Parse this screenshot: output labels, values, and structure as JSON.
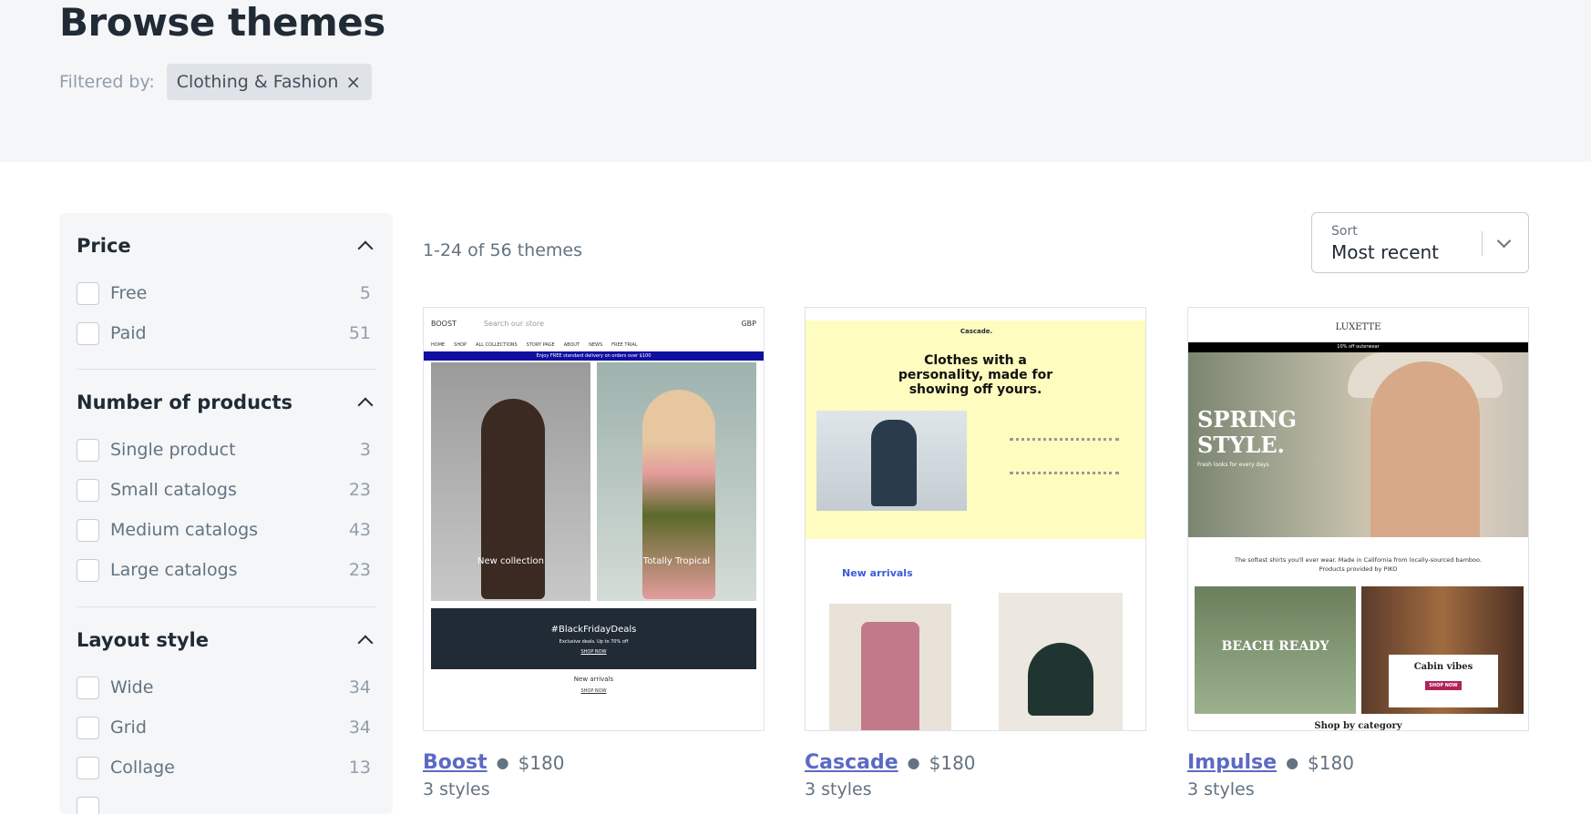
{
  "page": {
    "title": "Browse themes",
    "filter_label": "Filtered by:",
    "active_filter": "Clothing & Fashion",
    "remove_filter_glyph": "×"
  },
  "sidebar": {
    "sections": [
      {
        "title": "Price",
        "options": [
          {
            "label": "Free",
            "count": "5"
          },
          {
            "label": "Paid",
            "count": "51"
          }
        ]
      },
      {
        "title": "Number of products",
        "options": [
          {
            "label": "Single product",
            "count": "3"
          },
          {
            "label": "Small catalogs",
            "count": "23"
          },
          {
            "label": "Medium catalogs",
            "count": "43"
          },
          {
            "label": "Large catalogs",
            "count": "23"
          }
        ]
      },
      {
        "title": "Layout style",
        "options": [
          {
            "label": "Wide",
            "count": "34"
          },
          {
            "label": "Grid",
            "count": "34"
          },
          {
            "label": "Collage",
            "count": "13"
          }
        ]
      }
    ]
  },
  "results": {
    "summary": "1-24 of 56 themes"
  },
  "sort": {
    "label": "Sort",
    "value": "Most recent"
  },
  "themes": [
    {
      "name": "Boost",
      "price": "$180",
      "styles": "3 styles",
      "preview": {
        "logo": "BOOST",
        "search": "Search our store",
        "currency": "GBP",
        "nav": [
          "HOME",
          "SHOP",
          "ALL COLLECTIONS",
          "STORY PAGE",
          "ABOUT",
          "NEWS",
          "FREE TRIAL"
        ],
        "banner": "Enjoy FREE standard delivery on orders over $100",
        "caption1": "New collection",
        "caption2": "Totally Tropical",
        "promo": "#BlackFridayDeals",
        "promo_sub": "Exclusive deals. Up to 70% off",
        "promo_link": "SHOP NOW",
        "section": "New arrivals",
        "section_link": "SHOP NOW"
      }
    },
    {
      "name": "Cascade",
      "price": "$180",
      "styles": "3 styles",
      "preview": {
        "logo": "Cascade.",
        "headline": "Clothes with a personality, made for showing off yours.",
        "section": "New arrivals"
      }
    },
    {
      "name": "Impulse",
      "price": "$180",
      "styles": "3 styles",
      "preview": {
        "logo": "LUXETTE",
        "bar": "10% off outerwear",
        "hero": "SPRING STYLE.",
        "hero_sub": "Fresh looks for every days",
        "tagline": "The softest shirts you'll ever wear. Made in California from locally-sourced bamboo.",
        "tagline2": "Products provided by PIKO",
        "block1": "BEACH READY",
        "block2": "Cabin vibes",
        "block2_btn": "SHOP NOW",
        "category": "Shop by category"
      }
    }
  ],
  "colors": {
    "hero_bg": "#f4f6f8",
    "link": "#5c6ac4",
    "text": "#212b36",
    "muted": "#637381"
  }
}
